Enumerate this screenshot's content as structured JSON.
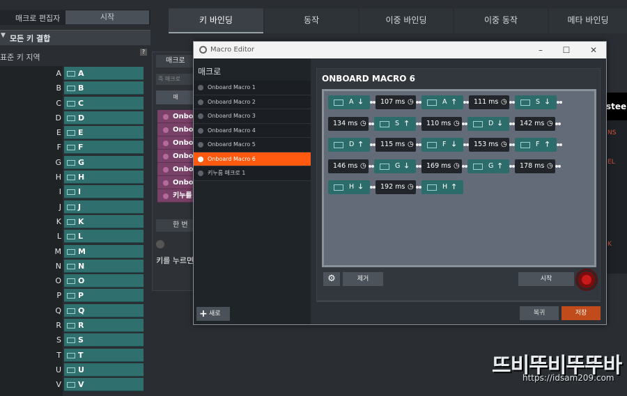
{
  "app": {
    "title_label": "매크로 편집자",
    "start_label": "시작",
    "key_combo_section": "모든 키 결합",
    "standard_region": "표준 키 지역",
    "help": "?"
  },
  "key_rows": [
    {
      "key": "A",
      "value": "A"
    },
    {
      "key": "B",
      "value": "B"
    },
    {
      "key": "C",
      "value": "C"
    },
    {
      "key": "D",
      "value": "D"
    },
    {
      "key": "E",
      "value": "E"
    },
    {
      "key": "F",
      "value": "F"
    },
    {
      "key": "G",
      "value": "G"
    },
    {
      "key": "H",
      "value": "H"
    },
    {
      "key": "I",
      "value": "I"
    },
    {
      "key": "J",
      "value": "J"
    },
    {
      "key": "K",
      "value": "K"
    },
    {
      "key": "L",
      "value": "L"
    },
    {
      "key": "M",
      "value": "M"
    },
    {
      "key": "N",
      "value": "N"
    },
    {
      "key": "O",
      "value": "O"
    },
    {
      "key": "P",
      "value": "P"
    },
    {
      "key": "Q",
      "value": "Q"
    },
    {
      "key": "R",
      "value": "R"
    },
    {
      "key": "S",
      "value": "S"
    },
    {
      "key": "T",
      "value": "T"
    },
    {
      "key": "U",
      "value": "U"
    },
    {
      "key": "V",
      "value": "V"
    }
  ],
  "top_tabs": [
    "키 바인딩",
    "동작",
    "이중 바인딩",
    "이중 동작",
    "메타 바인딩"
  ],
  "middle_panel": {
    "header": "매크로",
    "search_placeholder": "즉 매크로",
    "button": "매",
    "items": [
      "Onbo",
      "Onbo",
      "Onbo",
      "Onbo",
      "Onbo",
      "Onbo",
      "키누를"
    ],
    "once_label": "한 번",
    "press_text": "키를 누르면"
  },
  "right_edge": {
    "steel": "stee",
    "n": "NS",
    "el": "EL",
    "k": "K"
  },
  "dialog": {
    "title": "Macro Editor",
    "macro_heading": "매크로",
    "macros": [
      "Onboard Macro 1",
      "Onboard Macro 2",
      "Onboard Macro 3",
      "Onboard Macro 4",
      "Onboard Macro 5",
      "Onboard Macro 6",
      "키누름 매크로 1"
    ],
    "selected_index": 5,
    "new_label": "새로",
    "editor_title": "ONBOARD MACRO 6",
    "steps": [
      {
        "type": "key",
        "key": "A",
        "dir": "down"
      },
      {
        "type": "delay",
        "text": "107 ms"
      },
      {
        "type": "key",
        "key": "A",
        "dir": "up"
      },
      {
        "type": "delay",
        "text": "111 ms"
      },
      {
        "type": "key",
        "key": "S",
        "dir": "down"
      },
      {
        "type": "delay",
        "text": "134 ms"
      },
      {
        "type": "key",
        "key": "S",
        "dir": "up"
      },
      {
        "type": "delay",
        "text": "110 ms"
      },
      {
        "type": "key",
        "key": "D",
        "dir": "down"
      },
      {
        "type": "delay",
        "text": "142 ms"
      },
      {
        "type": "key",
        "key": "D",
        "dir": "up"
      },
      {
        "type": "delay",
        "text": "115 ms"
      },
      {
        "type": "key",
        "key": "F",
        "dir": "down"
      },
      {
        "type": "delay",
        "text": "153 ms"
      },
      {
        "type": "key",
        "key": "F",
        "dir": "up"
      },
      {
        "type": "delay",
        "text": "146 ms"
      },
      {
        "type": "key",
        "key": "G",
        "dir": "down"
      },
      {
        "type": "delay",
        "text": "169 ms"
      },
      {
        "type": "key",
        "key": "G",
        "dir": "up"
      },
      {
        "type": "delay",
        "text": "178 ms"
      },
      {
        "type": "key",
        "key": "H",
        "dir": "down"
      },
      {
        "type": "delay",
        "text": "192 ms"
      },
      {
        "type": "key",
        "key": "H",
        "dir": "up"
      }
    ],
    "remove_label": "제거",
    "start_label": "시작",
    "cancel_label": "복귀",
    "save_label": "저장"
  },
  "watermark": {
    "brand": "뜨비뚜비뚜뚜바",
    "url": "https://idsam209.com"
  },
  "colors": {
    "accent": "#ff5a0f",
    "key_teal": "#2c6d6b",
    "delay_dark": "#22262a",
    "save": "#c24b1c",
    "record": "#c81a1a"
  }
}
